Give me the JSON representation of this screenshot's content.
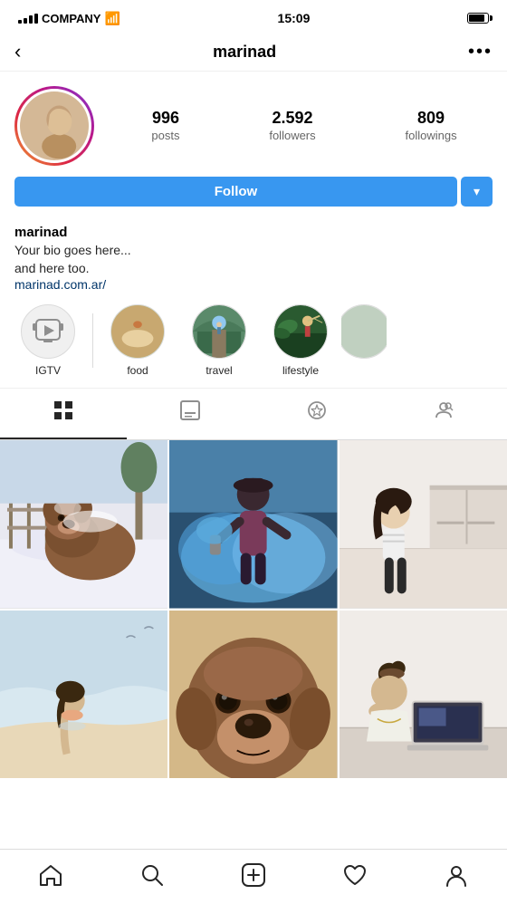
{
  "statusBar": {
    "carrier": "COMPANY",
    "time": "15:09"
  },
  "topNav": {
    "backLabel": "‹",
    "username": "marinad",
    "moreLabel": "•••"
  },
  "profileStats": {
    "postsCount": "996",
    "postsLabel": "posts",
    "followersCount": "2.592",
    "followersLabel": "followers",
    "followingCount": "809",
    "followingLabel": "followings"
  },
  "followButton": {
    "label": "Follow",
    "dropdownIcon": "▾"
  },
  "bio": {
    "username": "marinad",
    "line1": "Your bio goes here...",
    "line2": "and here too.",
    "link": "marinad.com.ar/"
  },
  "stories": [
    {
      "id": "igtv",
      "label": "IGTV",
      "type": "igtv"
    },
    {
      "id": "food",
      "label": "food",
      "type": "image"
    },
    {
      "id": "travel",
      "label": "travel",
      "type": "image"
    },
    {
      "id": "lifestyle",
      "label": "lifestyle",
      "type": "image"
    }
  ],
  "tabs": [
    {
      "id": "grid",
      "label": "Grid",
      "active": true
    },
    {
      "id": "feed",
      "label": "Feed",
      "active": false
    },
    {
      "id": "tagged-starred",
      "label": "Tagged Star",
      "active": false
    },
    {
      "id": "tagged",
      "label": "Tagged",
      "active": false
    }
  ],
  "photos": [
    {
      "id": 1,
      "type": "dog-snow",
      "colors": [
        "#8B6347",
        "#d4c5b0",
        "#fff",
        "#c8a882"
      ]
    },
    {
      "id": 2,
      "type": "smoke-blue",
      "colors": [
        "#4a7fa5",
        "#2b5f8a",
        "#8fc4d6",
        "#5d4a6e"
      ]
    },
    {
      "id": 3,
      "type": "girl-white",
      "colors": [
        "#e8e0d8",
        "#c8b8a8",
        "#f5f0ec",
        "#b0a090"
      ]
    },
    {
      "id": 4,
      "type": "girl-pink",
      "colors": [
        "#e8c8b0",
        "#d4a890",
        "#f0e0d0",
        "#c8988a"
      ]
    },
    {
      "id": 5,
      "type": "dog-brown",
      "colors": [
        "#8B5E3C",
        "#6B4423",
        "#c8a882",
        "#4a3020"
      ]
    },
    {
      "id": 6,
      "type": "laptop-girl",
      "colors": [
        "#d8d8d8",
        "#e8e0d8",
        "#a0a0a0",
        "#888888"
      ]
    }
  ],
  "bottomNav": {
    "home": "⌂",
    "search": "○",
    "add": "+",
    "heart": "♡",
    "profile": "👤"
  }
}
